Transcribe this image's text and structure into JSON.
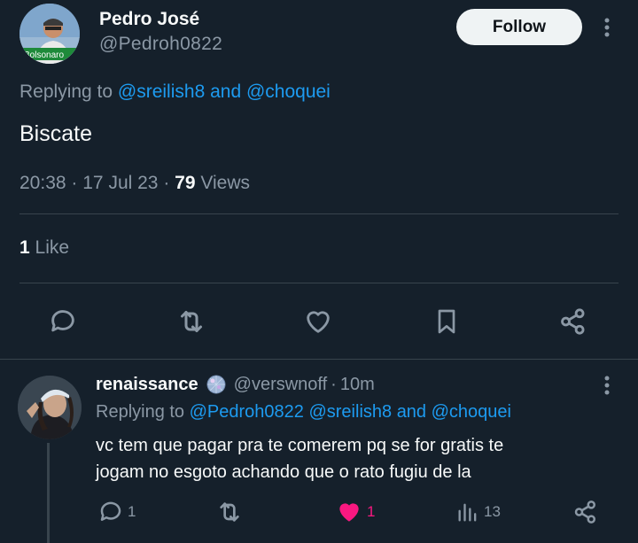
{
  "main_tweet": {
    "author_name": "Pedro José",
    "author_handle": "@Pedroh0822",
    "avatar_banner_text": "Bolsonaro",
    "follow_label": "Follow",
    "replying_prefix": "Replying to",
    "replying_to": "@sreilish8 and @choquei",
    "text": "Biscate",
    "time": "20:38",
    "date": "17 Jul 23",
    "views_count": "79",
    "views_label": "Views",
    "likes_count": "1",
    "likes_label": "Like"
  },
  "actions": [
    "reply-icon",
    "retweet-icon",
    "like-icon",
    "bookmark-icon",
    "share-icon"
  ],
  "reply": {
    "author_name": "renaissance",
    "author_handle": "@verswnoff",
    "time": "10m",
    "replying_prefix": "Replying to",
    "replying_to": "@Pedroh0822 @sreilish8 and @choquei",
    "text_line1": "vc tem que pagar pra te comerem pq se for gratis te",
    "text_line2": "jogam no esgoto achando que o rato fugiu de la",
    "reply_count": "1",
    "like_count": "1",
    "views_count": "13"
  },
  "colors": {
    "background": "#15202b",
    "link": "#1d9bf0",
    "muted": "#8b98a5",
    "like_active": "#f91880"
  }
}
